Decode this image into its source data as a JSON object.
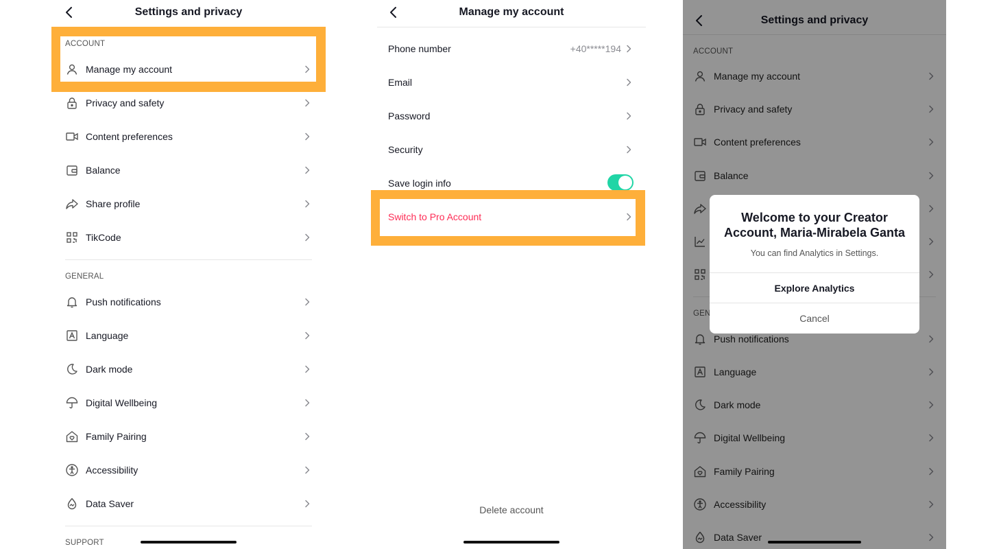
{
  "left_panel": {
    "title": "Settings and privacy",
    "account_header": "ACCOUNT",
    "account_items": [
      {
        "label": "Manage my account",
        "icon": "person-icon"
      },
      {
        "label": "Privacy and safety",
        "icon": "lock-icon"
      },
      {
        "label": "Content preferences",
        "icon": "video-icon"
      },
      {
        "label": "Balance",
        "icon": "wallet-icon"
      },
      {
        "label": "Share profile",
        "icon": "share-icon"
      },
      {
        "label": "TikCode",
        "icon": "qr-code-icon"
      }
    ],
    "general_header": "GENERAL",
    "general_items": [
      {
        "label": "Push notifications",
        "icon": "bell-icon"
      },
      {
        "label": "Language",
        "icon": "language-icon"
      },
      {
        "label": "Dark mode",
        "icon": "moon-icon"
      },
      {
        "label": "Digital Wellbeing",
        "icon": "umbrella-icon"
      },
      {
        "label": "Family Pairing",
        "icon": "home-heart-icon"
      },
      {
        "label": "Accessibility",
        "icon": "accessibility-icon"
      },
      {
        "label": "Data Saver",
        "icon": "droplet-icon"
      }
    ],
    "support_header": "SUPPORT"
  },
  "middle_panel": {
    "title": "Manage my account",
    "items": [
      {
        "label": "Phone number",
        "value": "+40*****194"
      },
      {
        "label": "Email",
        "value": ""
      },
      {
        "label": "Password",
        "value": ""
      },
      {
        "label": "Security",
        "value": ""
      }
    ],
    "save_login_label": "Save login info",
    "save_login_enabled": true,
    "switch_pro_label": "Switch to Pro Account",
    "delete_label": "Delete account"
  },
  "right_panel": {
    "title": "Settings and privacy",
    "account_header": "ACCOUNT",
    "account_items": [
      {
        "label": "Manage my account"
      },
      {
        "label": "Privacy and safety"
      },
      {
        "label": "Content preferences"
      },
      {
        "label": "Balance"
      }
    ],
    "general_header_partial": "GEN",
    "general_items": [
      {
        "label": "Push notifications"
      },
      {
        "label": "Language"
      },
      {
        "label": "Dark mode"
      },
      {
        "label": "Digital Wellbeing"
      },
      {
        "label": "Family Pairing"
      },
      {
        "label": "Accessibility"
      },
      {
        "label": "Data Saver"
      }
    ]
  },
  "modal": {
    "title": "Welcome to your Creator Account, Maria-Mirabela Ganta",
    "subtitle": "You can find Analytics in Settings.",
    "primary_button": "Explore Analytics",
    "secondary_button": "Cancel"
  },
  "colors": {
    "highlight": "#FEAF3A",
    "toggle_on": "#20D5A6",
    "pro_text": "#FE2C55",
    "text": "#161823"
  }
}
